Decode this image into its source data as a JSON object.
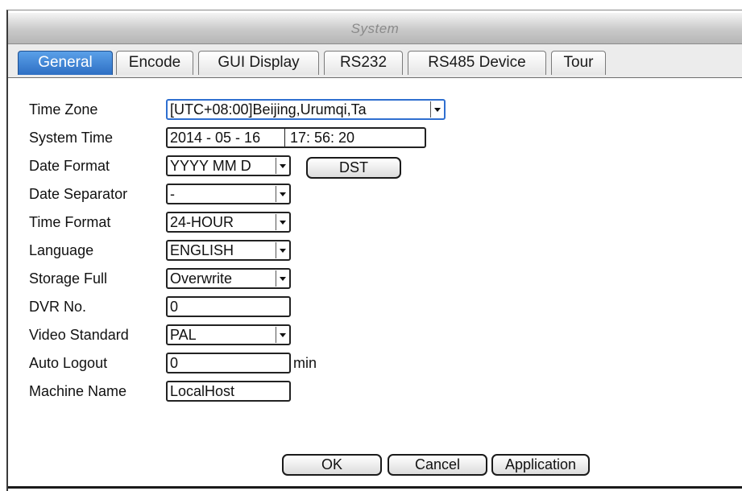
{
  "window": {
    "title": "System"
  },
  "tabs": [
    {
      "label": "General",
      "active": true
    },
    {
      "label": "Encode"
    },
    {
      "label": "GUI Display"
    },
    {
      "label": "RS232"
    },
    {
      "label": "RS485 Device"
    },
    {
      "label": "Tour"
    }
  ],
  "form": {
    "time_zone": {
      "label": "Time Zone",
      "value": "[UTC+08:00]Beijing,Urumqi,Ta"
    },
    "system_time": {
      "label": "System Time",
      "date": "2014 - 05 - 16",
      "time": "17: 56: 20"
    },
    "date_format": {
      "label": "Date Format",
      "value": "YYYY MM D",
      "dst_label": "DST"
    },
    "date_separator": {
      "label": "Date Separator",
      "value": "-"
    },
    "time_format": {
      "label": "Time Format",
      "value": "24-HOUR"
    },
    "language": {
      "label": "Language",
      "value": "ENGLISH"
    },
    "storage_full": {
      "label": "Storage Full",
      "value": "Overwrite"
    },
    "dvr_no": {
      "label": "DVR No.",
      "value": "0"
    },
    "video_standard": {
      "label": "Video Standard",
      "value": "PAL"
    },
    "auto_logout": {
      "label": "Auto Logout",
      "value": "0",
      "unit": "min"
    },
    "machine_name": {
      "label": "Machine Name",
      "value": "LocalHost"
    }
  },
  "buttons": {
    "ok": "OK",
    "cancel": "Cancel",
    "application": "Application"
  },
  "colors": {
    "active_tab": "#2e6fc4",
    "focus_border": "#2f6fd0"
  }
}
